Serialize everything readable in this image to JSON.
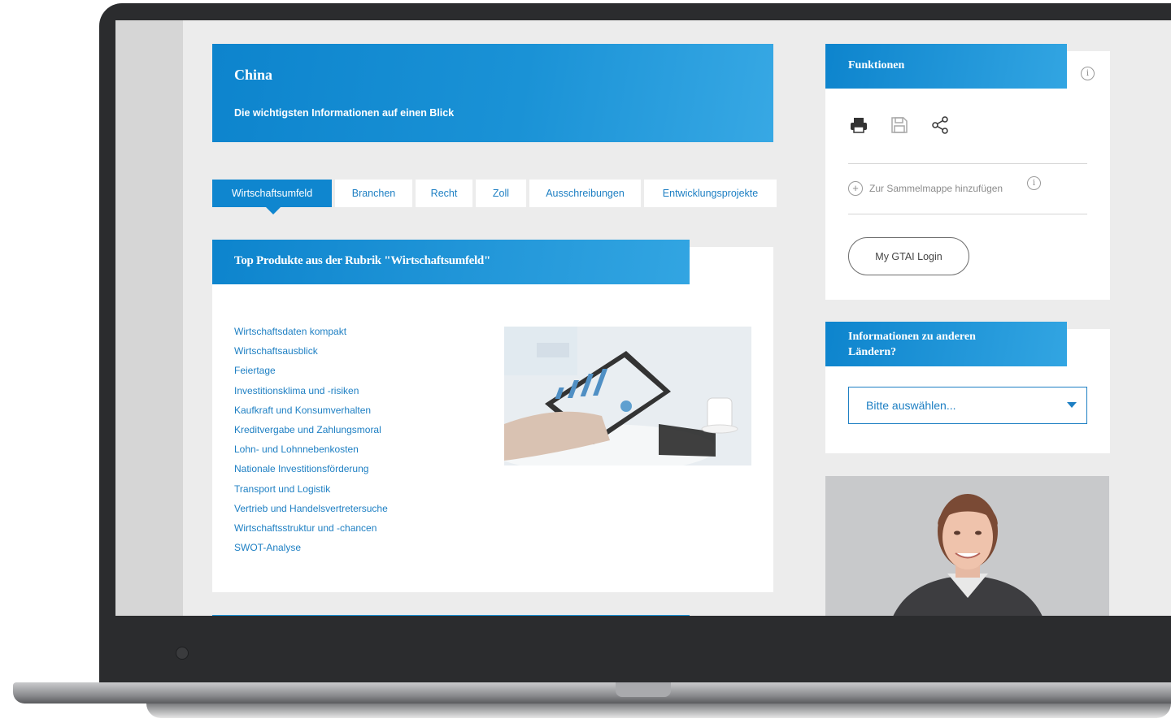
{
  "hero": {
    "title": "China",
    "subtitle": "Die wichtigsten Informationen auf einen Blick"
  },
  "tabs": [
    {
      "label": "Wirtschaftsumfeld",
      "active": true
    },
    {
      "label": "Branchen",
      "active": false
    },
    {
      "label": "Recht",
      "active": false
    },
    {
      "label": "Zoll",
      "active": false
    },
    {
      "label": "Ausschreibungen",
      "active": false
    },
    {
      "label": "Entwicklungsprojekte",
      "active": false
    }
  ],
  "products": {
    "heading": "Top Produkte aus der Rubrik \"Wirtschaftsumfeld\"",
    "items": [
      "Wirtschaftsdaten kompakt",
      "Wirtschaftsausblick",
      "Feiertage",
      "Investitionsklima und -risiken",
      "Kaufkraft und Konsumverhalten",
      "Kreditvergabe und Zahlungsmoral",
      "Lohn- und Lohnnebenkosten",
      "Nationale Investitionsförderung",
      "Transport und Logistik",
      "Vertrieb und Handelsvertretersuche",
      "Wirtschaftsstruktur und -chancen",
      "SWOT-Analyse"
    ]
  },
  "functions": {
    "heading": "Funktionen",
    "icons": [
      "print-icon",
      "save-icon",
      "share-icon"
    ],
    "add_collection_label": "Zur Sammelmappe hinzufügen",
    "login_label": "My GTAI Login"
  },
  "countries": {
    "heading": "Informationen zu anderen Ländern?",
    "select_value": "Bitte auswählen..."
  },
  "colors": {
    "brand_blue": "#0f86cf",
    "link_blue": "#1d7fc3",
    "page_bg": "#ececec"
  }
}
